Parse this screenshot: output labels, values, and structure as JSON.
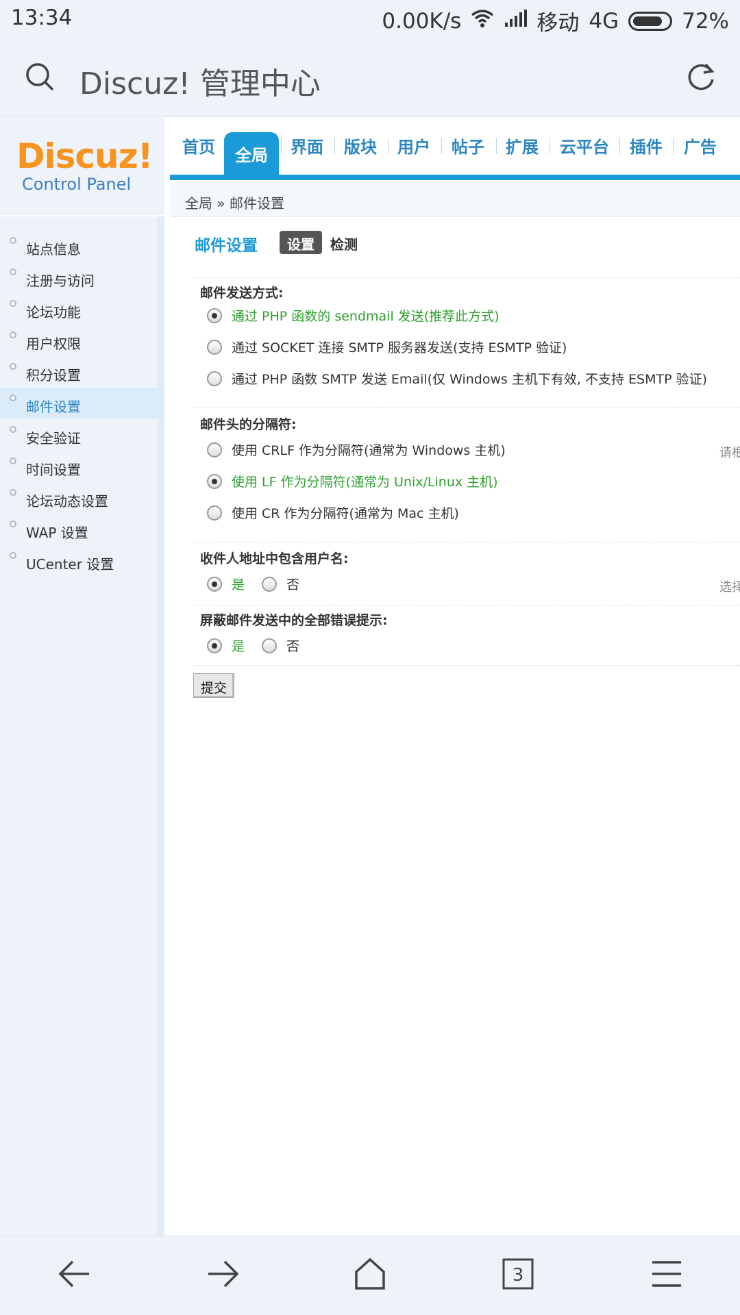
{
  "status_bar": {
    "time": "13:34",
    "speed": "0.00K/s",
    "carrier": "移动",
    "network": "4G",
    "battery": "72%"
  },
  "browser": {
    "title": "Discuz! 管理中心",
    "tabs_count": "3"
  },
  "logo": {
    "brand": "Discuz!",
    "subtitle": "Control Panel"
  },
  "nav": {
    "items": [
      "首页",
      "全局",
      "界面",
      "版块",
      "用户",
      "帖子",
      "扩展",
      "云平台",
      "插件",
      "广告"
    ],
    "active": "全局"
  },
  "breadcrumb": "全局 » 邮件设置",
  "sidebar": {
    "items": [
      "站点信息",
      "注册与访问",
      "论坛功能",
      "用户权限",
      "积分设置",
      "邮件设置",
      "安全验证",
      "时间设置",
      "论坛动态设置",
      "WAP 设置",
      "UCenter 设置"
    ],
    "active_index": 5
  },
  "content": {
    "title": "邮件设置",
    "tab_settings": "设置",
    "tab_check": "检测",
    "sections": [
      {
        "title": "邮件发送方式:",
        "options": [
          {
            "label": "通过 PHP 函数的 sendmail 发送(推荐此方式)",
            "selected": true
          },
          {
            "label": "通过 SOCKET 连接 SMTP 服务器发送(支持 ESMTP 验证)",
            "selected": false
          },
          {
            "label": "通过 PHP 函数 SMTP 发送 Email(仅 Windows 主机下有效, 不支持 ESMTP 验证)",
            "selected": false
          }
        ]
      },
      {
        "title": "邮件头的分隔符:",
        "hint": "请根",
        "options": [
          {
            "label": "使用 CRLF 作为分隔符(通常为 Windows 主机)",
            "selected": false
          },
          {
            "label": "使用 LF 作为分隔符(通常为 Unix/Linux 主机)",
            "selected": true
          },
          {
            "label": "使用 CR 作为分隔符(通常为 Mac 主机)",
            "selected": false
          }
        ]
      },
      {
        "title": "收件人地址中包含用户名:",
        "hint": "选择",
        "options": [
          {
            "label": "是",
            "selected": true
          },
          {
            "label": "否",
            "selected": false
          }
        ]
      },
      {
        "title": "屏蔽邮件发送中的全部错误提示:",
        "options": [
          {
            "label": "是",
            "selected": true
          },
          {
            "label": "否",
            "selected": false
          }
        ]
      }
    ],
    "submit_label": "提交"
  }
}
